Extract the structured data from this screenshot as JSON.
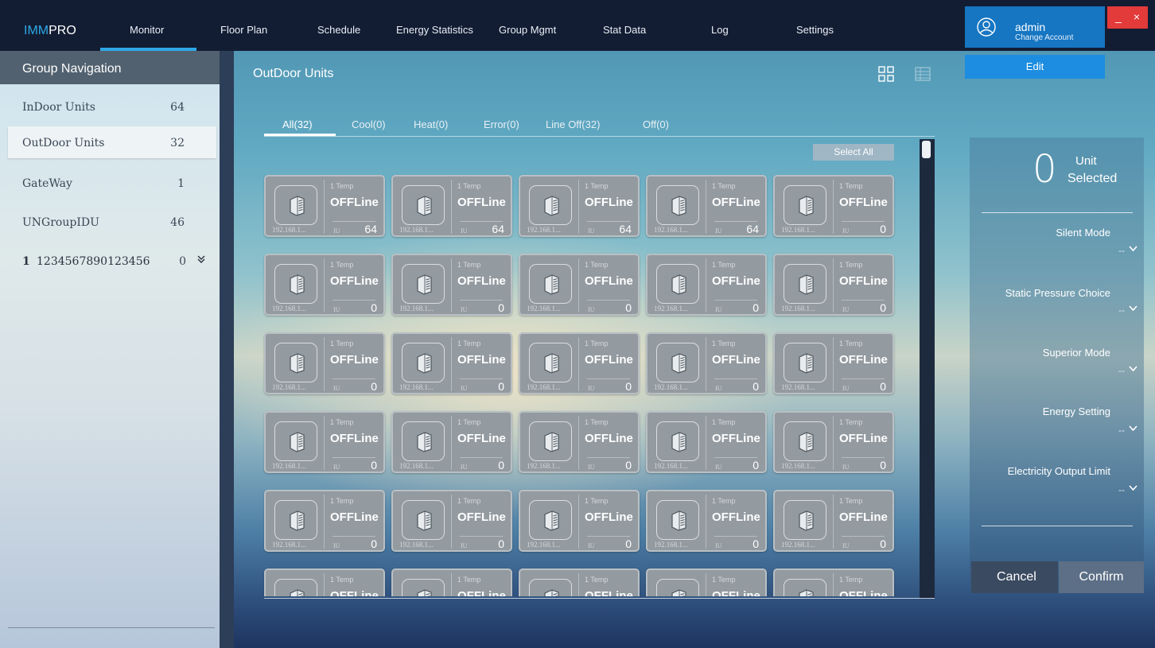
{
  "app": {
    "brand_prefix": "IMM",
    "brand_suffix": "PRO",
    "brand_color": "#2ea8e6"
  },
  "nav": {
    "items": [
      "Monitor",
      "Floor Plan",
      "Schedule",
      "Energy Statistics",
      "Group Mgmt",
      "Stat Data",
      "Log",
      "Settings"
    ],
    "active": "Monitor"
  },
  "user": {
    "name": "admin",
    "sub": "Change Account",
    "edit_label": "Edit",
    "avatar_icon": "user-circle-icon",
    "minimize_glyph": "_",
    "close_glyph": "×"
  },
  "sidebar": {
    "title": "Group Navigation",
    "items": [
      {
        "label": "InDoor Units",
        "count": "64"
      },
      {
        "label": "OutDoor Units",
        "count": "32"
      },
      {
        "label": "GateWay",
        "count": "1"
      },
      {
        "label": "UNGroupIDU",
        "count": "46"
      }
    ],
    "group": {
      "number": "1",
      "name": "1234567890123456",
      "count": "0",
      "chevron": "»"
    },
    "selected_index": 1
  },
  "main": {
    "title": "OutDoor Units",
    "view_icons": [
      "grid-view-icon",
      "list-view-icon"
    ],
    "tabs": [
      "All(32)",
      "Cool(0)",
      "Heat(0)",
      "Error(0)",
      "Line Off(32)",
      "Off(0)"
    ],
    "active_tab": "All(32)",
    "select_all_label": "Select All"
  },
  "cards": [
    {
      "temp": "1 Temp",
      "status": "OFFLine",
      "ip": "192.168.1...",
      "iu": "IU",
      "count": "64"
    },
    {
      "temp": "1 Temp",
      "status": "OFFLine",
      "ip": "192.168.1...",
      "iu": "IU",
      "count": "64"
    },
    {
      "temp": "1 Temp",
      "status": "OFFLine",
      "ip": "192.168.1...",
      "iu": "IU",
      "count": "64"
    },
    {
      "temp": "1 Temp",
      "status": "OFFLine",
      "ip": "192.168.1...",
      "iu": "IU",
      "count": "64"
    },
    {
      "temp": "1 Temp",
      "status": "OFFLine",
      "ip": "192.168.1...",
      "iu": "IU",
      "count": "0"
    },
    {
      "temp": "1 Temp",
      "status": "OFFLine",
      "ip": "192.168.1...",
      "iu": "IU",
      "count": "0"
    },
    {
      "temp": "1 Temp",
      "status": "OFFLine",
      "ip": "192.168.1...",
      "iu": "IU",
      "count": "0"
    },
    {
      "temp": "1 Temp",
      "status": "OFFLine",
      "ip": "192.168.1...",
      "iu": "IU",
      "count": "0"
    },
    {
      "temp": "1 Temp",
      "status": "OFFLine",
      "ip": "192.168.1...",
      "iu": "IU",
      "count": "0"
    },
    {
      "temp": "1 Temp",
      "status": "OFFLine",
      "ip": "192.168.1...",
      "iu": "IU",
      "count": "0"
    },
    {
      "temp": "1 Temp",
      "status": "OFFLine",
      "ip": "192.168.1...",
      "iu": "IU",
      "count": "0"
    },
    {
      "temp": "1 Temp",
      "status": "OFFLine",
      "ip": "192.168.1...",
      "iu": "IU",
      "count": "0"
    },
    {
      "temp": "1 Temp",
      "status": "OFFLine",
      "ip": "192.168.1...",
      "iu": "IU",
      "count": "0"
    },
    {
      "temp": "1 Temp",
      "status": "OFFLine",
      "ip": "192.168.1...",
      "iu": "IU",
      "count": "0"
    },
    {
      "temp": "1 Temp",
      "status": "OFFLine",
      "ip": "192.168.1...",
      "iu": "IU",
      "count": "0"
    },
    {
      "temp": "1 Temp",
      "status": "OFFLine",
      "ip": "192.168.1...",
      "iu": "IU",
      "count": "0"
    },
    {
      "temp": "1 Temp",
      "status": "OFFLine",
      "ip": "192.168.1...",
      "iu": "IU",
      "count": "0"
    },
    {
      "temp": "1 Temp",
      "status": "OFFLine",
      "ip": "192.168.1...",
      "iu": "IU",
      "count": "0"
    },
    {
      "temp": "1 Temp",
      "status": "OFFLine",
      "ip": "192.168.1...",
      "iu": "IU",
      "count": "0"
    },
    {
      "temp": "1 Temp",
      "status": "OFFLine",
      "ip": "192.168.1...",
      "iu": "IU",
      "count": "0"
    },
    {
      "temp": "1 Temp",
      "status": "OFFLine",
      "ip": "192.168.1...",
      "iu": "IU",
      "count": "0"
    },
    {
      "temp": "1 Temp",
      "status": "OFFLine",
      "ip": "192.168.1...",
      "iu": "IU",
      "count": "0"
    },
    {
      "temp": "1 Temp",
      "status": "OFFLine",
      "ip": "192.168.1...",
      "iu": "IU",
      "count": "0"
    },
    {
      "temp": "1 Temp",
      "status": "OFFLine",
      "ip": "192.168.1...",
      "iu": "IU",
      "count": "0"
    },
    {
      "temp": "1 Temp",
      "status": "OFFLine",
      "ip": "192.168.1...",
      "iu": "IU",
      "count": "0"
    },
    {
      "temp": "1 Temp",
      "status": "OFFLine",
      "ip": "192.168.1...",
      "iu": "IU",
      "count": ""
    },
    {
      "temp": "1 Temp",
      "status": "OFFLine",
      "ip": "192.168.1...",
      "iu": "IU",
      "count": ""
    },
    {
      "temp": "1 Temp",
      "status": "OFFLine",
      "ip": "192.168.1...",
      "iu": "IU",
      "count": ""
    },
    {
      "temp": "1 Temp",
      "status": "OFFLine",
      "ip": "192.168.1...",
      "iu": "IU",
      "count": ""
    },
    {
      "temp": "1 Temp",
      "status": "OFFLine",
      "ip": "192.168.1...",
      "iu": "IU",
      "count": ""
    }
  ],
  "card_icon": "outdoor-unit-icon",
  "right_panel": {
    "selected_count": "0",
    "unit_label": "Unit",
    "selected_label": "Selected",
    "options": [
      {
        "label": "Silent Mode",
        "value": "--"
      },
      {
        "label": "Static Pressure Choice",
        "value": "--"
      },
      {
        "label": "Superior Mode",
        "value": "--"
      },
      {
        "label": "Energy Setting",
        "value": "--"
      },
      {
        "label": "Electricity Output Limit",
        "value": "--"
      }
    ],
    "cancel_label": "Cancel",
    "confirm_label": "Confirm"
  }
}
